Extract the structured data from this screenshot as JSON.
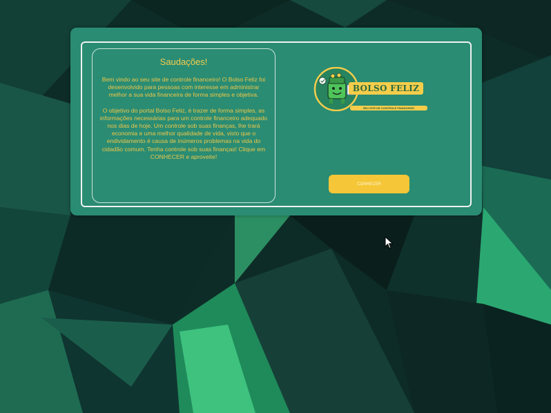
{
  "welcome": {
    "title": "Saudações!",
    "paragraph_1": "Bem vindo ao seu site de controle financeiro! O Bolso Feliz foi desenvolvido para pessoas com interesse em administrar melhor a sua vida financeira de forma simples e objetiva.",
    "paragraph_2": "O objetivo do portal Bolso Feliz, é trazer de forma simples, as informações necessárias para um controle financeiro adequado nos dias de hoje. Um controle sob suas finanças, lhe trará economia e uma melhor qualidade de vida, visto que o endividamento é causa de inúmeros problemas na vida do cidadão comum. Tenha controle sob suas finanças! Clique em CONHECER e aproveite!"
  },
  "logo": {
    "title": "BOLSO FELIZ",
    "subtitle": "SEU SITE DE CONTROLE FINANCEIRO"
  },
  "actions": {
    "conhecer_label": "CONHECER"
  },
  "icons": {
    "logo_mascot": "wallet-mascot-icon",
    "cursor": "mouse-pointer-icon"
  },
  "colors": {
    "card": "#2a8c73",
    "accent": "#f5c637",
    "text": "#efc74a",
    "background": "#0d2a25"
  }
}
